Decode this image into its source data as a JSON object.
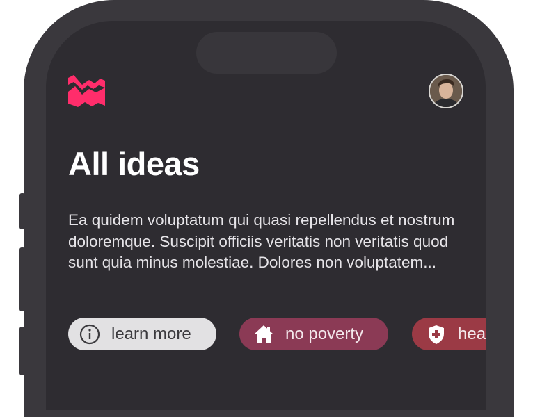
{
  "header": {
    "logo": "brand-logo",
    "avatar": "user-avatar"
  },
  "main": {
    "title": "All ideas",
    "description": "Ea quidem voluptatum qui quasi repellendus et nostrum doloremque. Suscipit officiis veritatis non veritatis quod sunt quia minus molestiae. Dolores non voluptatem..."
  },
  "chips": [
    {
      "label": "learn more",
      "icon": "info-icon",
      "color": "#e2e1e3"
    },
    {
      "label": "no poverty",
      "icon": "house-icon",
      "color": "#8b3a55"
    },
    {
      "label": "health",
      "icon": "shield-plus-icon",
      "color": "#9b3a45"
    }
  ],
  "colors": {
    "frame": "#3a383d",
    "screen": "#2e2c31",
    "brand_accent": "#ff2d6b"
  }
}
